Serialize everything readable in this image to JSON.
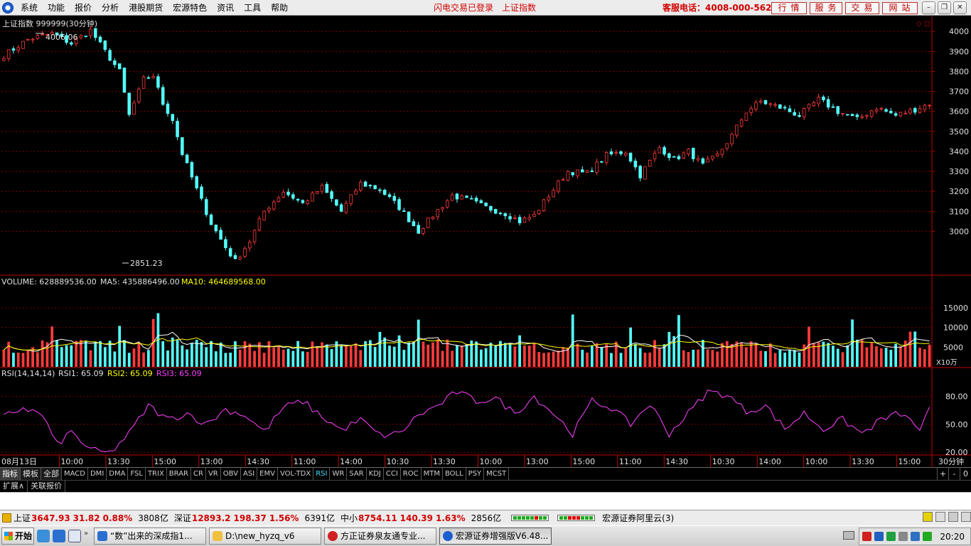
{
  "menu": {
    "items": [
      "系统",
      "功能",
      "报价",
      "分析",
      "港股期货",
      "宏源特色",
      "资讯",
      "工具",
      "帮助"
    ],
    "login_status": "闪电交易已登录",
    "current_index": "上证指数",
    "hotline": "客服电话：4008-000-562",
    "quick_buttons": [
      "行情",
      "服务",
      "交易",
      "网站"
    ]
  },
  "chart": {
    "title": "上证指数 999999(30分钟)",
    "high_label": "4006.06",
    "low_label": "2851.23",
    "volume_header": {
      "vol": "VOLUME: 628889536.00",
      "ma5": "MA5: 435886496.00",
      "ma10": "MA10: 464689568.00"
    },
    "volume_unit": "X10万",
    "rsi_header": {
      "name": "RSI(14,14,14)",
      "rsi1": "RSI1: 65.09",
      "rsi2": "RSI2: 65.09",
      "rsi3": "RSI3: 65.09"
    },
    "period_label": "30分钟",
    "colors": {
      "up": "#ff3b3b",
      "down": "#54ffff",
      "rsi": "#ff40ff",
      "ma5": "#ffffff",
      "ma10": "#ffff00",
      "axis": "#c00000"
    }
  },
  "chart_data": {
    "type": "candlestick",
    "price_axis_ticks": [
      "4000",
      "3900",
      "3800",
      "3700",
      "3600",
      "3500",
      "3400",
      "3300",
      "3200",
      "3100",
      "3000"
    ],
    "price_ylim": [
      2820,
      4040
    ],
    "volume_axis_ticks": [
      "15000",
      "10000",
      "5000"
    ],
    "volume_ylim": [
      0,
      19000
    ],
    "rsi_axis_ticks": [
      "80.00",
      "50.00",
      "20.00"
    ],
    "rsi_ylim": [
      17,
      95
    ],
    "time_ticks": [
      "08月13日",
      "10:00",
      "13:30",
      "15:00",
      "13:00",
      "14:30",
      "11:00",
      "14:00",
      "10:30",
      "13:30",
      "10:00",
      "13:00",
      "15:00",
      "11:00",
      "14:30",
      "10:30",
      "14:00",
      "10:00",
      "13:30",
      "15:00"
    ],
    "close_path": [
      [
        0,
        3880
      ],
      [
        5,
        3960
      ],
      [
        10,
        3990
      ],
      [
        14,
        3940
      ],
      [
        18,
        4006
      ],
      [
        21,
        3900
      ],
      [
        24,
        3800
      ],
      [
        26,
        3580
      ],
      [
        29,
        3760
      ],
      [
        31,
        3780
      ],
      [
        33,
        3640
      ],
      [
        35,
        3560
      ],
      [
        37,
        3390
      ],
      [
        40,
        3210
      ],
      [
        43,
        3040
      ],
      [
        46,
        2920
      ],
      [
        48,
        2851
      ],
      [
        51,
        2950
      ],
      [
        54,
        3100
      ],
      [
        58,
        3200
      ],
      [
        62,
        3140
      ],
      [
        66,
        3220
      ],
      [
        70,
        3100
      ],
      [
        74,
        3240
      ],
      [
        78,
        3210
      ],
      [
        82,
        3120
      ],
      [
        86,
        3000
      ],
      [
        89,
        3080
      ],
      [
        93,
        3180
      ],
      [
        97,
        3150
      ],
      [
        100,
        3120
      ],
      [
        104,
        3090
      ],
      [
        107,
        3050
      ],
      [
        110,
        3080
      ],
      [
        113,
        3180
      ],
      [
        117,
        3300
      ],
      [
        121,
        3290
      ],
      [
        125,
        3380
      ],
      [
        129,
        3400
      ],
      [
        132,
        3280
      ],
      [
        136,
        3420
      ],
      [
        139,
        3360
      ],
      [
        142,
        3400
      ],
      [
        145,
        3330
      ],
      [
        148,
        3380
      ],
      [
        151,
        3480
      ],
      [
        154,
        3600
      ],
      [
        157,
        3650
      ],
      [
        161,
        3620
      ],
      [
        165,
        3580
      ],
      [
        169,
        3660
      ],
      [
        173,
        3600
      ],
      [
        177,
        3560
      ],
      [
        181,
        3620
      ],
      [
        185,
        3580
      ],
      [
        189,
        3610
      ],
      [
        192,
        3640
      ]
    ],
    "candle_count": 193,
    "rsi_path": [
      [
        0,
        58
      ],
      [
        4,
        68
      ],
      [
        8,
        60
      ],
      [
        11,
        28
      ],
      [
        14,
        42
      ],
      [
        18,
        22
      ],
      [
        22,
        19
      ],
      [
        26,
        40
      ],
      [
        30,
        70
      ],
      [
        34,
        55
      ],
      [
        38,
        62
      ],
      [
        42,
        50
      ],
      [
        46,
        66
      ],
      [
        50,
        60
      ],
      [
        54,
        42
      ],
      [
        58,
        68
      ],
      [
        62,
        75
      ],
      [
        66,
        58
      ],
      [
        70,
        44
      ],
      [
        74,
        55
      ],
      [
        78,
        38
      ],
      [
        82,
        40
      ],
      [
        86,
        60
      ],
      [
        90,
        70
      ],
      [
        94,
        85
      ],
      [
        98,
        75
      ],
      [
        102,
        78
      ],
      [
        106,
        62
      ],
      [
        110,
        80
      ],
      [
        114,
        62
      ],
      [
        118,
        40
      ],
      [
        122,
        75
      ],
      [
        126,
        68
      ],
      [
        130,
        50
      ],
      [
        134,
        72
      ],
      [
        138,
        40
      ],
      [
        142,
        62
      ],
      [
        146,
        85
      ],
      [
        150,
        82
      ],
      [
        154,
        64
      ],
      [
        158,
        70
      ],
      [
        162,
        45
      ],
      [
        166,
        62
      ],
      [
        170,
        45
      ],
      [
        174,
        55
      ],
      [
        178,
        40
      ],
      [
        182,
        55
      ],
      [
        186,
        62
      ],
      [
        190,
        45
      ],
      [
        192,
        65
      ]
    ]
  },
  "indicator_tabs": {
    "cn": [
      "指标",
      "模板",
      "全部"
    ],
    "items": [
      "MACD",
      "DMI",
      "DMA",
      "FSL",
      "TRIX",
      "BRAR",
      "CR",
      "VR",
      "OBV",
      "ASI",
      "EMV",
      "VOL-TDX",
      "RSI",
      "WR",
      "SAR",
      "KDJ",
      "CCI",
      "ROC",
      "MTM",
      "BOLL",
      "PSY",
      "MCST"
    ],
    "active": "RSI",
    "right_controls": [
      "+",
      "-",
      "0"
    ]
  },
  "ext_tabs": [
    "扩展∧",
    "关联报价"
  ],
  "statusbar": {
    "sh_label": "上证",
    "sh_value": "3647.93",
    "sh_change": "31.82",
    "sh_pct": "0.88%",
    "sh_amount": "3808亿",
    "sz_label": "深证",
    "sz_value": "12893.2",
    "sz_change": "198.37",
    "sz_pct": "1.56%",
    "sz_amount": "6391亿",
    "zx_label": "中小",
    "zx_value": "8754.11",
    "zx_change": "140.39",
    "zx_pct": "1.63%",
    "zx_amount": "2856亿",
    "broker": "宏源证券阿里云(3)"
  },
  "taskbar": {
    "start": "开始",
    "tasks": [
      "“数”出来的深成指1...",
      "D:\\new_hyzq_v6",
      "方正证券泉友通专业...",
      "宏源证券增强版V6.48..."
    ],
    "clock": "20:20"
  }
}
